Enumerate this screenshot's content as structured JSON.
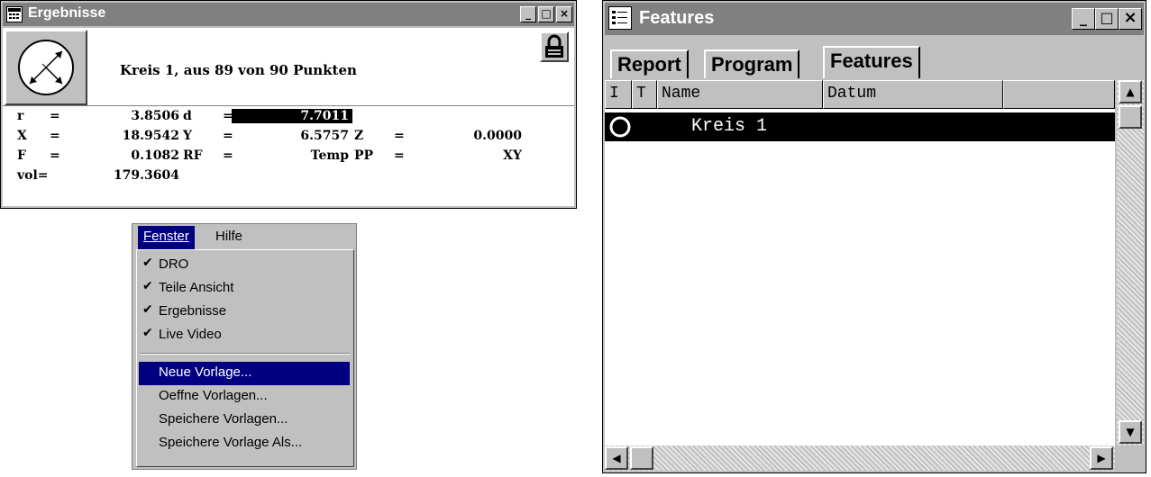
{
  "results_window": {
    "title": "Ergebnisse",
    "feature_header": "Kreis 1, aus 89 von 90 Punkten",
    "rows": [
      {
        "c1_label": "r",
        "c1_eq": "=",
        "c1_value": "3.8506",
        "c2_label": "d",
        "c2_eq": "=",
        "c2_value": "7.7011",
        "c3_label": "",
        "c3_eq": "",
        "c3_value": ""
      },
      {
        "c1_label": "X",
        "c1_eq": "=",
        "c1_value": "18.9542",
        "c2_label": "Y",
        "c2_eq": "=",
        "c2_value": "6.5757",
        "c3_label": "Z",
        "c3_eq": "=",
        "c3_value": "0.0000"
      },
      {
        "c1_label": "F",
        "c1_eq": "=",
        "c1_value": "0.1082",
        "c2_label": "RF",
        "c2_eq": "=",
        "c2_value": "Temp",
        "c3_label": "PP",
        "c3_eq": "=",
        "c3_value": "XY"
      },
      {
        "c1_label": "vol=",
        "c1_eq": "",
        "c1_value": "179.3604",
        "c2_label": "",
        "c2_eq": "",
        "c2_value": "",
        "c3_label": "",
        "c3_eq": "",
        "c3_value": ""
      }
    ]
  },
  "menu": {
    "bar": [
      "Fenster",
      "Hilfe"
    ],
    "items": [
      {
        "label": "DRO",
        "checked": true
      },
      {
        "label": "Teile Ansicht",
        "checked": true
      },
      {
        "label": "Ergebnisse",
        "checked": true
      },
      {
        "label": "Live Video",
        "checked": true
      },
      {
        "label": "Neue Vorlage...",
        "checked": false,
        "highlighted": true
      },
      {
        "label": "Oeffne Vorlagen...",
        "checked": false
      },
      {
        "label": "Speichere Vorlagen...",
        "checked": false
      },
      {
        "label": "Speichere Vorlage Als...",
        "checked": false
      }
    ],
    "checkmark": "✔",
    "highlight_color": "#000080"
  },
  "features_window": {
    "title": "Features",
    "tabs": [
      "Report",
      "Program",
      "Features"
    ],
    "columns": [
      "I",
      "T",
      "Name",
      "Datum"
    ],
    "rows": [
      {
        "name": "Kreis 1",
        "datum": ""
      }
    ]
  }
}
